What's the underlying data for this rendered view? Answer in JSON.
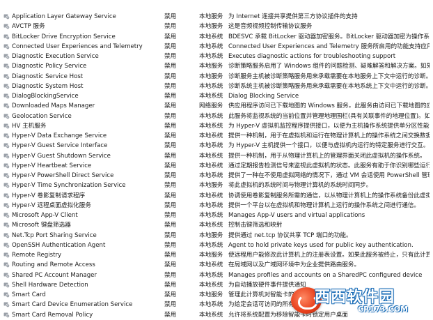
{
  "services": [
    {
      "name": "Application Layer Gateway Service",
      "startup": "禁用",
      "account": "本地服务",
      "description": "为 Internet 连接共享提供第三方协议插件的支持"
    },
    {
      "name": "AVCTP 服务",
      "startup": "禁用",
      "account": "本地服务",
      "description": "这是音频视频控制传输协议服务"
    },
    {
      "name": "BitLocker Drive Encryption Service",
      "startup": "禁用",
      "account": "本地系统",
      "description": "BDESVC 承载 BitLocker 驱动器加密服务。BitLocker 驱动器加密为操作系统提..."
    },
    {
      "name": "Connected User Experiences and Telemetry",
      "startup": "禁用",
      "account": "本地系统",
      "description": "Connected User Experiences and Telemetry 服务所启用的功能支持应用程序..."
    },
    {
      "name": "Diagnostic Execution Service",
      "startup": "禁用",
      "account": "本地系统",
      "description": "Executes diagnostic actions for troubleshooting support"
    },
    {
      "name": "Diagnostic Policy Service",
      "startup": "禁用",
      "account": "本地服务",
      "description": "诊断策略服务启用了 Windows 组件的问题检测、疑难解答和解决方案。如果该..."
    },
    {
      "name": "Diagnostic Service Host",
      "startup": "禁用",
      "account": "本地服务",
      "description": "诊断服务主机被诊断策略服务用来承载需要在本地服务上下文中运行的诊断。..."
    },
    {
      "name": "Diagnostic System Host",
      "startup": "禁用",
      "account": "本地系统",
      "description": "诊断系统主机被诊断策略服务用来承载需要在本地系统上下文中运行的诊断。..."
    },
    {
      "name": "DialogBlockingService",
      "startup": "禁用",
      "account": "本地系统",
      "description": "Dialog Blocking Service"
    },
    {
      "name": "Downloaded Maps Manager",
      "startup": "禁用",
      "account": "网络服务",
      "description": "供应用程序访问已下载地图的 Windows 服务。此服务由访问已下载地图的应用..."
    },
    {
      "name": "Geolocation Service",
      "startup": "禁用",
      "account": "本地系统",
      "description": "此服务将监视系统的当前位置并管理地理围栏(具有关联事件的地理位置)。如果..."
    },
    {
      "name": "HV 主机服务",
      "startup": "禁用",
      "account": "本地系统",
      "description": "为 Hyper-V 虚拟机监控程序提供接口，以便为主机操作系统提供单分区性能计..."
    },
    {
      "name": "Hyper-V Data Exchange Service",
      "startup": "禁用",
      "account": "本地系统",
      "description": "提供一种机制，用于在虚拟机和运行在物理计算机上的操作系统之间交换数据。"
    },
    {
      "name": "Hyper-V Guest Service Interface",
      "startup": "禁用",
      "account": "本地系统",
      "description": "为 Hyper-V 主机提供一个接口，以便与虚拟机内运行的特定服务进行交互。"
    },
    {
      "name": "Hyper-V Guest Shutdown Service",
      "startup": "禁用",
      "account": "本地系统",
      "description": "提供一种机制，用于从物理计算机上的管理界面关闭此虚拟机的操作系统。"
    },
    {
      "name": "Hyper-V Heartbeat Service",
      "startup": "禁用",
      "account": "本地系统",
      "description": "通过定期报告检测信号来监视此虚拟机的状态。此服务有助于你识别哪些运行..."
    },
    {
      "name": "Hyper-V PowerShell Direct Service",
      "startup": "禁用",
      "account": "本地系统",
      "description": "提供了一种在不使用虚拟网络的情况下，通过 VM 会话使用 PowerShell 管理虚..."
    },
    {
      "name": "Hyper-V Time Synchronization Service",
      "startup": "禁用",
      "account": "本地服务",
      "description": "将此虚拟机的系统时间与物理计算机的系统时间同步。"
    },
    {
      "name": "Hyper-V 卷影复制请求程序",
      "startup": "禁用",
      "account": "本地系统",
      "description": "协调使用卷影复制服务所需的通信，以从物理计算机上的操作系统备份此虚拟..."
    },
    {
      "name": "Hyper-V 远程桌面虚拟化服务",
      "startup": "禁用",
      "account": "本地系统",
      "description": "提供一个平台以在虚拟机和物理计算机上运行的操作系统之间进行通信。"
    },
    {
      "name": "Microsoft App-V Client",
      "startup": "禁用",
      "account": "本地系统",
      "description": "Manages App-V users and virtual applications"
    },
    {
      "name": "Microsoft 键盘筛选器",
      "startup": "禁用",
      "account": "本地系统",
      "description": "控制击键筛选和映射"
    },
    {
      "name": "Net.Tcp Port Sharing Service",
      "startup": "禁用",
      "account": "本地服务",
      "description": "提供通过 net.tcp 协议共享 TCP 端口的功能。"
    },
    {
      "name": "OpenSSH Authentication Agent",
      "startup": "禁用",
      "account": "本地系统",
      "description": "Agent to hold private keys used for public key authentication."
    },
    {
      "name": "Remote Registry",
      "startup": "禁用",
      "account": "本地服务",
      "description": "使远程用户能修改此计算机上的注册表设置。如果此服务被终止，只有此计算..."
    },
    {
      "name": "Routing and Remote Access",
      "startup": "禁用",
      "account": "本地系统",
      "description": "在局域网以及广域网环境中为企业提供路由服务。"
    },
    {
      "name": "Shared PC Account Manager",
      "startup": "禁用",
      "account": "本地系统",
      "description": "Manages profiles and accounts on a SharedPC configured device"
    },
    {
      "name": "Shell Hardware Detection",
      "startup": "禁用",
      "account": "本地系统",
      "description": "为自动播放硬件事件提供通知"
    },
    {
      "name": "Smart Card",
      "startup": "禁用",
      "account": "本地服务",
      "description": "管理此计算机对智能卡的取..."
    },
    {
      "name": "Smart Card Device Enumeration Service",
      "startup": "禁用",
      "account": "本地系统",
      "description": "为给定会话可访问的所有智..."
    },
    {
      "name": "Smart Card Removal Policy",
      "startup": "禁用",
      "account": "本地系统",
      "description": "允许将系统配置为移除智能卡时锁定用户桌面"
    }
  ],
  "watermark": {
    "main": "西西",
    "brand": "软件园",
    "sub": "CR173.COM"
  },
  "colors": {
    "gear_body": "#9aa0a8",
    "gear_hole": "#e8ecf0",
    "text": "#1a1a1a",
    "watermark_red": "#e8401c",
    "watermark_blue": "#1e6fb8"
  }
}
